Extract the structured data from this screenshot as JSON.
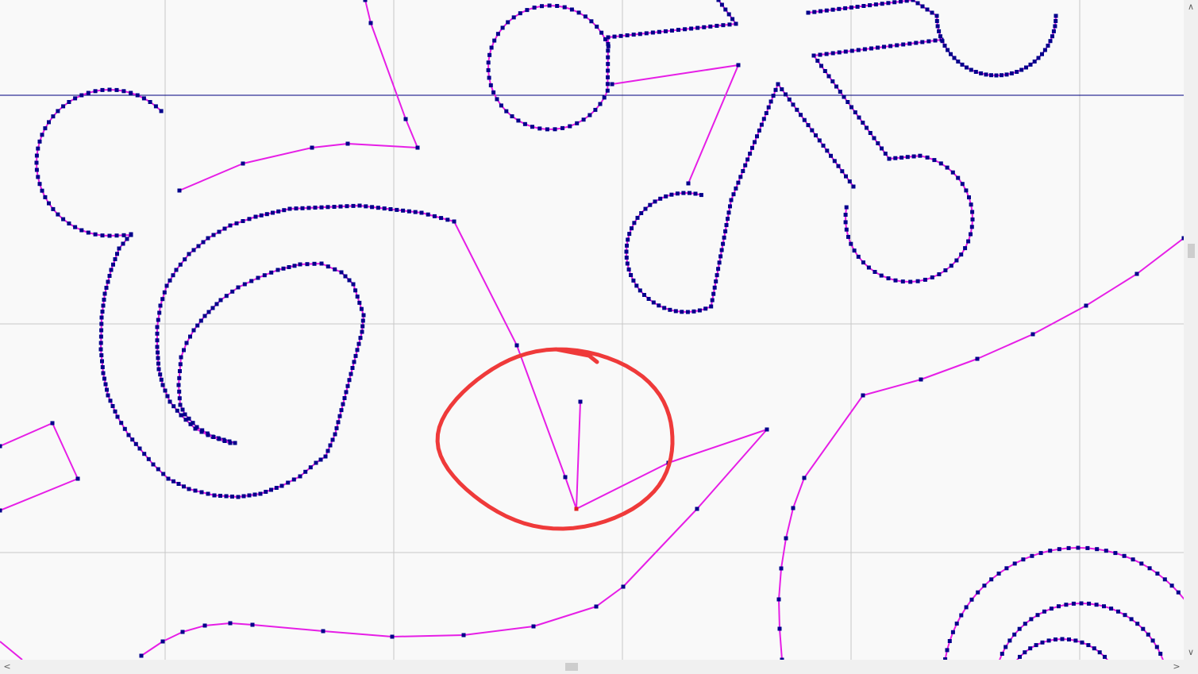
{
  "colors": {
    "background": "#f9f9f9",
    "grid": "#c8c8c8",
    "guide": "#000080",
    "path": "#e61ee6",
    "node": "#00008b",
    "selected_node": "#e02020",
    "annotation": "#ef3a3a",
    "scrollbar": "#f0f0f0",
    "scroll_thumb": "#cdcdcd"
  },
  "icons": {
    "scroll_up": "chevron-up-icon",
    "scroll_down": "chevron-down-icon",
    "scroll_left": "chevron-left-icon",
    "scroll_right": "chevron-right-icon"
  },
  "scroll_arrows": {
    "up": "∧",
    "down": "∨",
    "left": "<",
    "right": ">"
  }
}
